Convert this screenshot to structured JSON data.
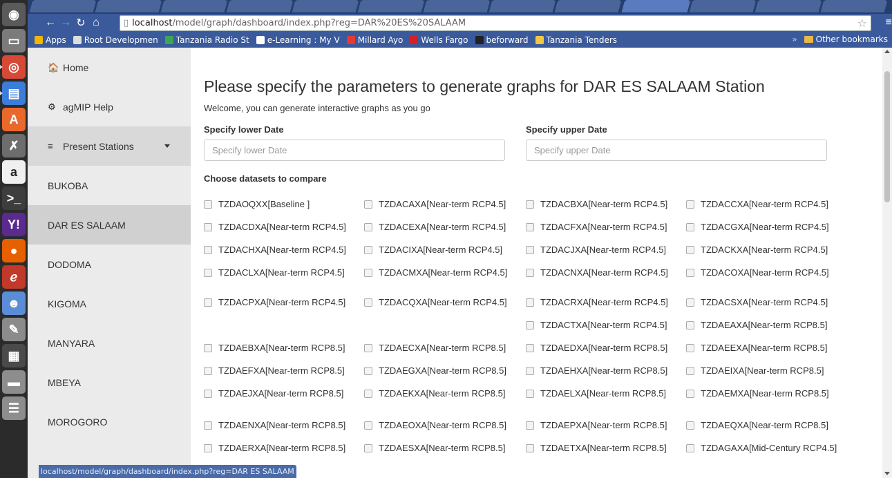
{
  "browser": {
    "address": {
      "host": "localhost",
      "path": "/model/graph/dashboard/index.php?reg=DAR%20ES%20SALAAM"
    },
    "bookmarks": [
      {
        "label": "Apps",
        "icon": "apps-grid-icon",
        "color": "#f4b400"
      },
      {
        "label": "Root Developmen",
        "icon": "page-icon",
        "color": "#dddddd"
      },
      {
        "label": "Tanzania Radio St",
        "icon": "plus-icon",
        "color": "#3aa757"
      },
      {
        "label": "e-Learning : My V",
        "icon": "uf-icon",
        "color": "#ffffff"
      },
      {
        "label": "Millard Ayo",
        "icon": "ayo-icon",
        "color": "#e53935"
      },
      {
        "label": "Wells Fargo",
        "icon": "wf-icon",
        "color": "#d71e28"
      },
      {
        "label": "beforward",
        "icon": "beforward-icon",
        "color": "#222222"
      },
      {
        "label": "Tanzania Tenders",
        "icon": "tenders-icon",
        "color": "#f2c744"
      }
    ],
    "other_bookmarks": "Other bookmarks",
    "status_url": "localhost/model/graph/dashboard/index.php?reg=DAR ES SALAAM"
  },
  "sidebar": {
    "items": [
      {
        "label": "Home",
        "icon": "home-icon",
        "glyph": "🏠"
      },
      {
        "label": "agMIP Help",
        "icon": "gear-icon",
        "glyph": "⚙"
      },
      {
        "label": "Present Stations",
        "icon": "database-icon",
        "glyph": "≡"
      },
      {
        "label": "BUKOBA"
      },
      {
        "label": "DAR ES SALAAM"
      },
      {
        "label": "DODOMA"
      },
      {
        "label": "KIGOMA"
      },
      {
        "label": "MANYARA"
      },
      {
        "label": "MBEYA"
      },
      {
        "label": "MOROGORO"
      }
    ]
  },
  "main": {
    "title": "Please specify the parameters to generate graphs for DAR ES SALAAM Station",
    "welcome": "Welcome, you can generate interactive graphs as you go",
    "lower_label": "Specify lower Date",
    "lower_placeholder": "Specify lower Date",
    "upper_label": "Specify upper Date",
    "upper_placeholder": "Specify upper Date",
    "datasets_label": "Choose datasets to compare",
    "datasets": [
      [
        "TZDAOQXX[Baseline ]",
        "TZDACAXA[Near-term RCP4.5]",
        "TZDACBXA[Near-term RCP4.5]",
        "TZDACCXA[Near-term RCP4.5]"
      ],
      [
        "TZDACDXA[Near-term RCP4.5]",
        "TZDACEXA[Near-term RCP4.5]",
        "TZDACFXA[Near-term RCP4.5]",
        "TZDACGXA[Near-term RCP4.5]"
      ],
      [
        "TZDACHXA[Near-term RCP4.5]",
        "TZDACIXA[Near-term RCP4.5]",
        "TZDACJXA[Near-term RCP4.5]",
        "TZDACKXA[Near-term RCP4.5]"
      ],
      [
        "TZDACLXA[Near-term RCP4.5]",
        "TZDACMXA[Near-term RCP4.5]",
        "TZDACNXA[Near-term RCP4.5]",
        "TZDACOXA[Near-term RCP4.5]"
      ],
      [
        "TZDACPXA[Near-term RCP4.5]",
        "TZDACQXA[Near-term RCP4.5]",
        "TZDACRXA[Near-term RCP4.5]",
        "TZDACSXA[Near-term RCP4.5]"
      ],
      [
        "",
        "",
        "TZDACTXA[Near-term RCP4.5]",
        "TZDAEAXA[Near-term RCP8.5]"
      ],
      [
        "TZDAEBXA[Near-term RCP8.5]",
        "TZDAECXA[Near-term RCP8.5]",
        "TZDAEDXA[Near-term RCP8.5]",
        "TZDAEEXA[Near-term RCP8.5]"
      ],
      [
        "TZDAEFXA[Near-term RCP8.5]",
        "TZDAEGXA[Near-term RCP8.5]",
        "TZDAEHXA[Near-term RCP8.5]",
        "TZDAEIXA[Near-term RCP8.5]"
      ],
      [
        "TZDAEJXA[Near-term RCP8.5]",
        "TZDAEKXA[Near-term RCP8.5]",
        "TZDAELXA[Near-term RCP8.5]",
        "TZDAEMXA[Near-term RCP8.5]"
      ],
      [
        "TZDAENXA[Near-term RCP8.5]",
        "TZDAEOXA[Near-term RCP8.5]",
        "TZDAEPXA[Near-term RCP8.5]",
        "TZDAEQXA[Near-term RCP8.5]"
      ],
      [
        "TZDAERXA[Near-term RCP8.5]",
        "TZDAESXA[Near-term RCP8.5]",
        "TZDAETXA[Near-term RCP8.5]",
        "TZDAGAXA[Mid-Century RCP4.5]"
      ]
    ]
  },
  "launcher": {
    "apps": [
      {
        "icon": "dash-icon",
        "bg": "#5a5a5a",
        "glyph": "◉"
      },
      {
        "icon": "files-icon",
        "bg": "#7b7b7b",
        "glyph": "▭"
      },
      {
        "icon": "chrome-icon",
        "bg": "#d64937",
        "glyph": "◎"
      },
      {
        "icon": "document-icon",
        "bg": "#3b7dd8",
        "glyph": "▤"
      },
      {
        "icon": "software-center-icon",
        "bg": "#e9692c",
        "glyph": "A"
      },
      {
        "icon": "settings-tools-icon",
        "bg": "#6d6d6d",
        "glyph": "✗"
      },
      {
        "icon": "amazon-icon",
        "bg": "#f0f0f0",
        "glyph": "a"
      },
      {
        "icon": "terminal-icon",
        "bg": "#3d3d3d",
        "glyph": ">_"
      },
      {
        "icon": "yahoo-mail-icon",
        "bg": "#5b2a8e",
        "glyph": "Y!"
      },
      {
        "icon": "firefox-icon",
        "bg": "#e66000",
        "glyph": "●"
      },
      {
        "icon": "acrobat-icon",
        "bg": "#c0392b",
        "glyph": "ℯ"
      },
      {
        "icon": "pidgin-icon",
        "bg": "#5b8dd6",
        "glyph": "☻"
      },
      {
        "icon": "text-editor-icon",
        "bg": "#8b8b8b",
        "glyph": "✎"
      },
      {
        "icon": "workspaces-icon",
        "bg": "#4a4a4a",
        "glyph": "▦"
      },
      {
        "icon": "drive-icon",
        "bg": "#8d8d8d",
        "glyph": "▬"
      },
      {
        "icon": "trash-icon",
        "bg": "#8d8d8d",
        "glyph": "☰"
      }
    ]
  }
}
